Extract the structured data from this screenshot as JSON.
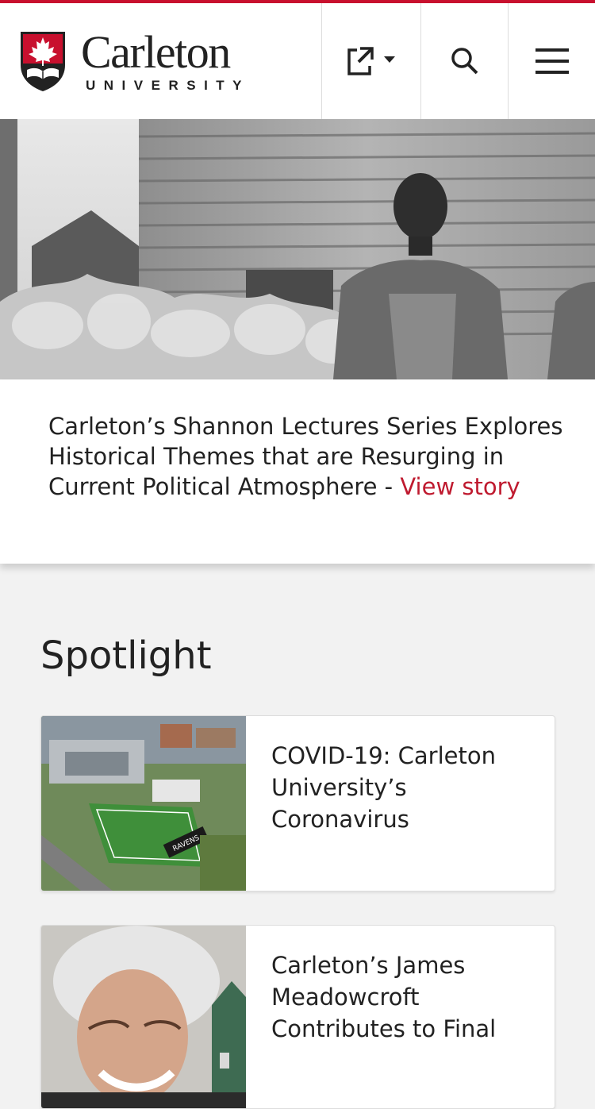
{
  "brand": {
    "name": "Carleton",
    "subtitle": "UNIVERSITY",
    "accent_color": "#c8102e",
    "link_color": "#bf1a2f"
  },
  "header": {
    "icons": [
      "external-share-icon",
      "search-icon",
      "hamburger-menu-icon"
    ]
  },
  "hero": {
    "headline": "Carleton’s Shannon Lectures Series Explores Historical Themes that are Resurging in Current Political Atmosphere",
    "separator": "-",
    "link_text": "View story"
  },
  "spotlight": {
    "heading": "Spotlight",
    "cards": [
      {
        "title": "COVID-19: Carleton University’s Coronavirus"
      },
      {
        "title": "Carleton’s James Meadowcroft Contributes to Final"
      }
    ]
  }
}
